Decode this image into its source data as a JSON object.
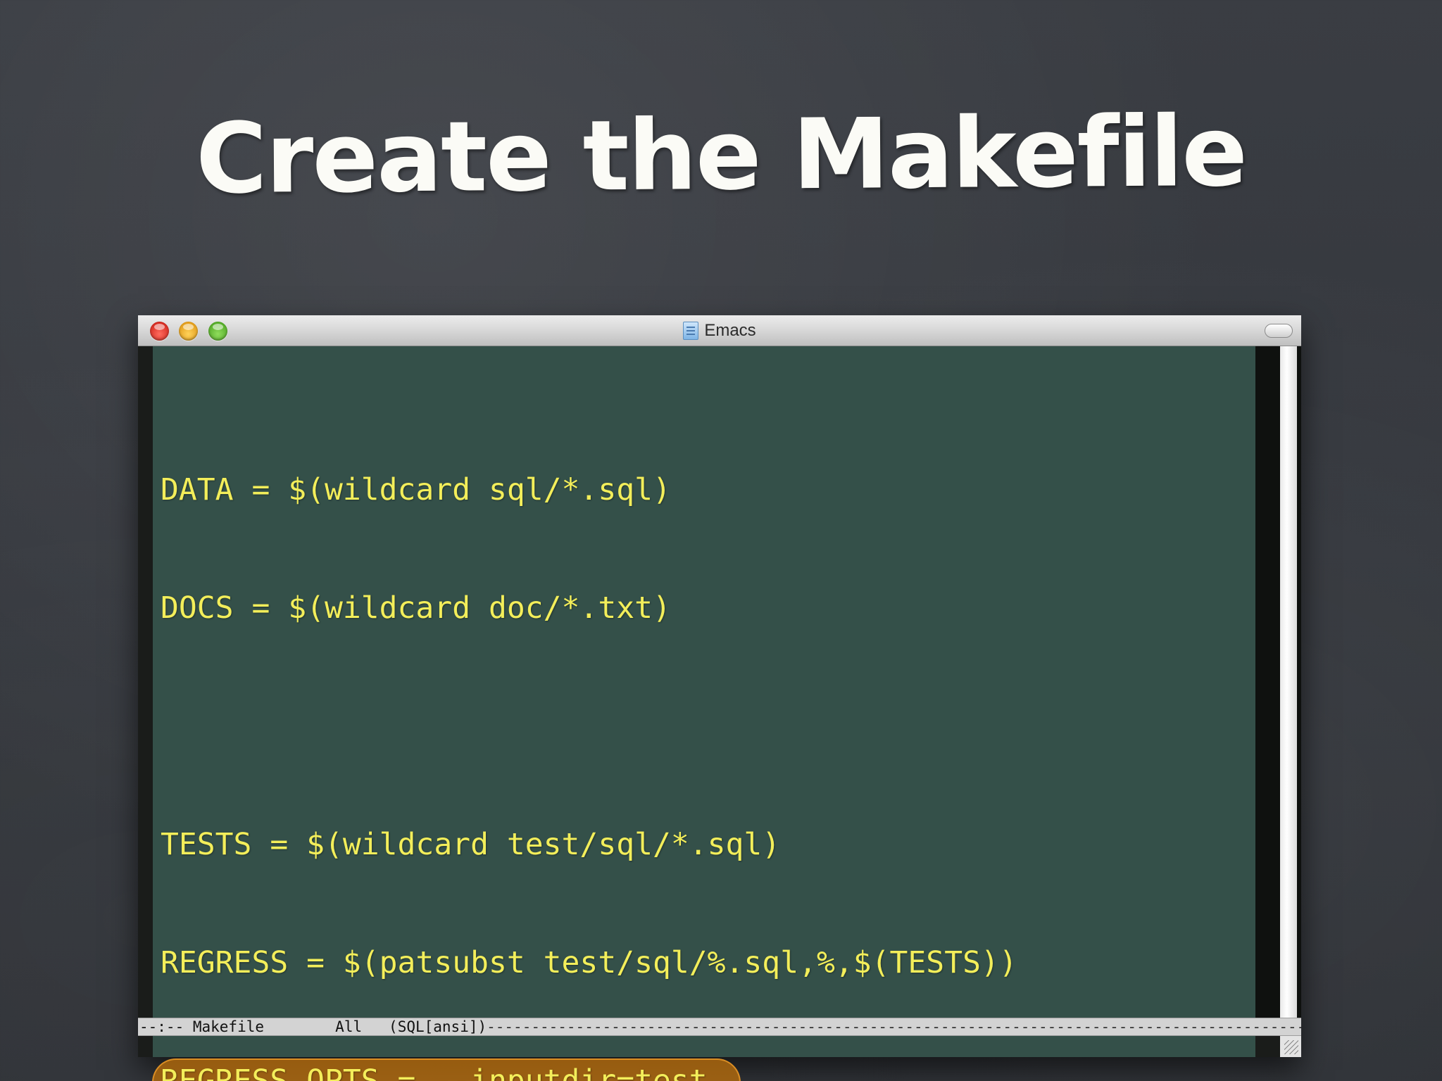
{
  "slide": {
    "title": "Create the Makefile"
  },
  "window": {
    "title": "Emacs",
    "icon": "document-icon"
  },
  "editor": {
    "lines": [
      "DATA = $(wildcard sql/*.sql)",
      "DOCS = $(wildcard doc/*.txt)",
      "",
      "TESTS = $(wildcard test/sql/*.sql)",
      "REGRESS = $(patsubst test/sql/%.sql,%,$(TESTS))",
      "REGRESS_OPTS = --inputdir=test"
    ],
    "highlighted_line": 5
  },
  "modeline": {
    "prefix": "--:-- ",
    "buffer_name": "Makefile",
    "position": "All",
    "mode": "(SQL[ansi])"
  },
  "colors": {
    "editor_bg": "#345049",
    "code_text": "#f3ee5a",
    "highlight": "#ba6e0c"
  }
}
